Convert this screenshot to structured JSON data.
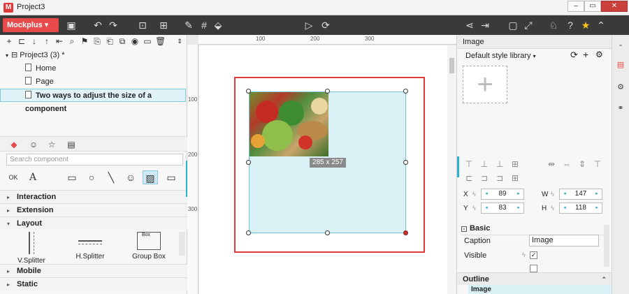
{
  "window": {
    "title": "Project3",
    "app_icon": "M"
  },
  "toolbar": {
    "brand": "Mockplus ▾"
  },
  "pages": {
    "project_label": "Project3 (3)",
    "project_mark": "*",
    "items": [
      "Home",
      "Page",
      "Two ways to adjust the size of a component"
    ]
  },
  "components": {
    "search_placeholder": "Search component",
    "categories": [
      "Interaction",
      "Extension",
      "Layout",
      "Mobile",
      "Static"
    ],
    "layout_items": [
      "V.Splitter",
      "H.Splitter",
      "Group Box"
    ],
    "group_box_caption": "Box"
  },
  "canvas": {
    "ruler_top": [
      "100",
      "200",
      "300"
    ],
    "ruler_left": [
      "100",
      "200",
      "300"
    ],
    "size_tooltip": "285 x 257"
  },
  "properties": {
    "panel_title": "Image",
    "library": "Default style library",
    "x_label": "X",
    "x_value": "89",
    "y_label": "Y",
    "y_value": "83",
    "w_label": "W",
    "w_value": "147",
    "h_label": "H",
    "h_value": "118",
    "basic_label": "Basic",
    "caption_label": "Caption",
    "caption_value": "Image",
    "visible_label": "Visible",
    "outline_label": "Outline",
    "outline_item": "Image"
  },
  "colors": {
    "brand": "#e94b4b",
    "selection": "#d9f0f5",
    "highlight": "#e03a3a"
  }
}
